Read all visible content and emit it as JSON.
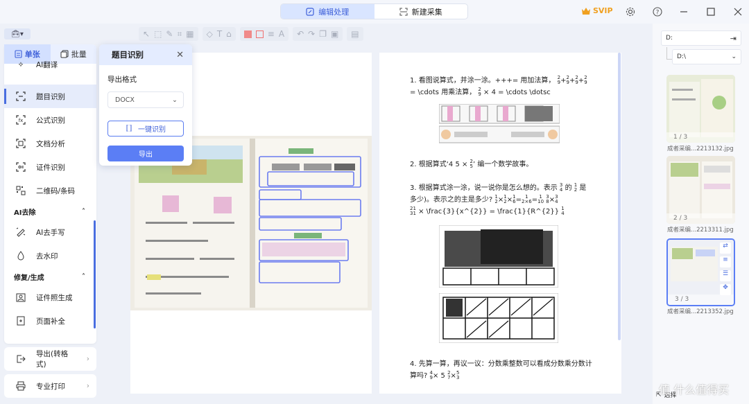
{
  "title_bar": {
    "tabs": [
      {
        "label": "编辑处理",
        "active": true
      },
      {
        "label": "新建采集",
        "active": false
      }
    ],
    "svip_label": "SVIP"
  },
  "left_panel": {
    "sub_tabs": [
      {
        "label": "单张",
        "active": true
      },
      {
        "label": "批量",
        "active": false
      }
    ],
    "menu_items": [
      {
        "label": "AI翻译",
        "icon": "translate-icon"
      },
      {
        "label": "题目识别",
        "icon": "scan-icon",
        "selected": true
      },
      {
        "label": "公式识别",
        "icon": "formula-icon"
      },
      {
        "label": "文档分析",
        "icon": "document-analysis-icon"
      },
      {
        "label": "证件识别",
        "icon": "id-card-icon"
      },
      {
        "label": "二维码/条码",
        "icon": "qrcode-icon"
      }
    ],
    "section_ai_remove": "AI去除",
    "ai_remove_items": [
      {
        "label": "AI去手写",
        "icon": "erase-handwriting-icon"
      },
      {
        "label": "去水印",
        "icon": "watermark-remove-icon"
      }
    ],
    "section_repair": "修复/生成",
    "repair_items": [
      {
        "label": "证件照生成",
        "icon": "id-photo-icon"
      },
      {
        "label": "页面补全",
        "icon": "page-complete-icon"
      }
    ],
    "export_label": "导出(转格式)",
    "print_label": "专业打印"
  },
  "popup": {
    "title": "题目识别",
    "format_label": "导出格式",
    "format_value": "DOCX",
    "recognize_label": "一键识别",
    "export_label": "导出"
  },
  "right_doc": {
    "q1_line1": "1. 看图说算式，并涂一涂。+++= 用加法算，",
    "q1_line2": "= \\cdots 用乘法算，",
    "q1_line2b": "× 4 = \\cdots \\dotsc",
    "q2": "2. 根据算式‘4 5 ×",
    "q2_end": "’ 编一个数学故事。",
    "q3_line1": "3. 根据算式涂一涂，说一说你是怎么想的。表示",
    "q3_mid": "的",
    "q3_end": "是",
    "q3_line2": "多少)。表示之的主是多少?",
    "q3_line3": "× \\frac{3}{x^{2}} = \\frac{1}{R^{2}}",
    "q4_line1": "4. 先算一算，再议一议：分数乘整数可以看成分数乘分数计",
    "q4_line2": "算吗?"
  },
  "thumbnails": {
    "path_value": "D:",
    "folder_value": "D:\\",
    "items": [
      {
        "page": "1 / 3",
        "name": "成者采编...2213132.jpg"
      },
      {
        "page": "2 / 3",
        "name": "成者采编...2213311.jpg"
      },
      {
        "page": "3 / 3",
        "name": "成者采编...2213352.jpg",
        "selected": true
      }
    ],
    "select_label": "选择"
  },
  "watermark_text": "值 什么值得买",
  "colors": {
    "accent": "#5b7ef5",
    "selected_bg": "#e6ecfb",
    "svip": "#f0a020"
  }
}
